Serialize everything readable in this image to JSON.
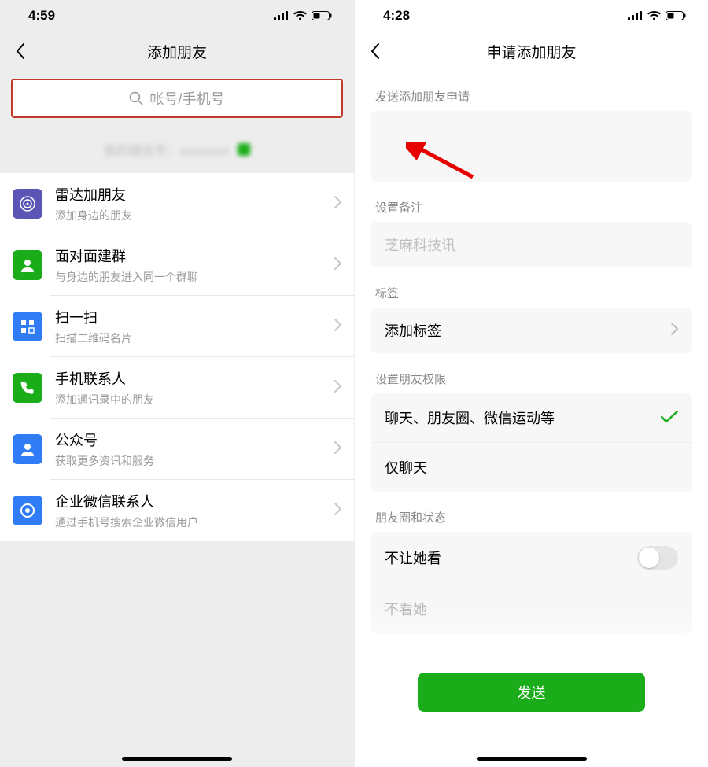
{
  "left": {
    "status_time": "4:59",
    "nav_title": "添加朋友",
    "search_placeholder": "帐号/手机号",
    "items": [
      {
        "icon": "radar",
        "color": "#5b55b5",
        "title": "雷达加朋友",
        "sub": "添加身边的朋友"
      },
      {
        "icon": "group",
        "color": "#1aad19",
        "title": "面对面建群",
        "sub": "与身边的朋友进入同一个群聊"
      },
      {
        "icon": "scan",
        "color": "#2f7cf6",
        "title": "扫一扫",
        "sub": "扫描二维码名片"
      },
      {
        "icon": "phone",
        "color": "#1aad19",
        "title": "手机联系人",
        "sub": "添加通讯录中的朋友"
      },
      {
        "icon": "official",
        "color": "#2f7cf6",
        "title": "公众号",
        "sub": "获取更多资讯和服务"
      },
      {
        "icon": "work",
        "color": "#2f7cf6",
        "title": "企业微信联系人",
        "sub": "通过手机号搜索企业微信用户"
      }
    ]
  },
  "right": {
    "status_time": "4:28",
    "nav_title": "申请添加朋友",
    "section_request": "发送添加朋友申请",
    "section_remark": "设置备注",
    "remark_placeholder": "芝麻科技讯",
    "section_tag": "标签",
    "tag_label": "添加标签",
    "section_perm": "设置朋友权限",
    "perm_full": "聊天、朋友圈、微信运动等",
    "perm_chat_only": "仅聊天",
    "section_moments": "朋友圈和状态",
    "moments_hide": "不让她看",
    "send_label": "发送"
  }
}
